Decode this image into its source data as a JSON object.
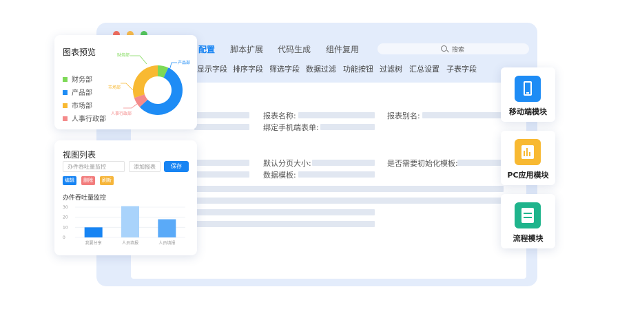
{
  "main_window": {
    "menu": [
      {
        "label": "配置",
        "active": true
      },
      {
        "label": "脚本扩展",
        "active": false
      },
      {
        "label": "代码生成",
        "active": false
      },
      {
        "label": "组件复用",
        "active": false
      }
    ],
    "search_placeholder": "搜索",
    "sub_tabs": [
      "显示字段",
      "排序字段",
      "筛选字段",
      "数据过滤",
      "功能按钮",
      "过滤树",
      "汇总设置",
      "子表字段"
    ],
    "form": {
      "report_name_label": "报表名称:",
      "report_alias_label": "报表别名:",
      "mobile_form_label": "绑定手机端表单:",
      "page_size_label": "默认分页大小:",
      "init_template_label": "是否需要初始化模板:",
      "data_template_label": "数据模板:"
    }
  },
  "chart_preview": {
    "title": "图表预览",
    "legend": [
      {
        "label": "财务部",
        "color": "#7ed957"
      },
      {
        "label": "产品部",
        "color": "#1e8cf5"
      },
      {
        "label": "市场部",
        "color": "#f8b932"
      },
      {
        "label": "人事行政部",
        "color": "#f48a8a"
      }
    ],
    "callouts": {
      "finance": "财务部",
      "product": "产品部",
      "market": "市场部",
      "hr": "人事行政部"
    }
  },
  "view_list": {
    "title": "视图列表",
    "name_field": "办件吞吐量监控",
    "add_report_button": "添加报表",
    "save_button": "保存",
    "tags": [
      {
        "label": "编辑",
        "color": "#1784f3"
      },
      {
        "label": "删除",
        "color": "#f27d7d"
      },
      {
        "label": "刷新",
        "color": "#f6b53a"
      }
    ],
    "subtitle": "办件吞吐量监控",
    "y_ticks": [
      "30",
      "20",
      "10",
      "0"
    ],
    "x_labels": [
      "我要分享",
      "人员填报",
      "人员填报"
    ]
  },
  "chart_data": [
    {
      "type": "pie",
      "title": "",
      "labels": [
        "财务部",
        "产品部",
        "人事行政部",
        "市场部"
      ],
      "values": [
        7,
        56,
        7,
        30
      ],
      "colors": [
        "#7ed957",
        "#1e8cf5",
        "#f48a8a",
        "#f8b932"
      ]
    },
    {
      "type": "bar",
      "title": "办件吞吐量监控",
      "categories": [
        "我要分享",
        "人员填报",
        "人员填报"
      ],
      "values": [
        10,
        31,
        18
      ],
      "colors": [
        "#1784f3",
        "#a9d3fb",
        "#5aaaf8"
      ],
      "ylim": [
        0,
        30
      ],
      "grid": true
    }
  ],
  "modules": [
    {
      "label": "移动端模块",
      "icon": "mobile-phone-icon",
      "color": "#1e8cf5"
    },
    {
      "label": "PC应用模块",
      "icon": "pc-chart-icon",
      "color": "#f8b932"
    },
    {
      "label": "流程模块",
      "icon": "flow-document-icon",
      "color": "#1fb48c"
    }
  ]
}
